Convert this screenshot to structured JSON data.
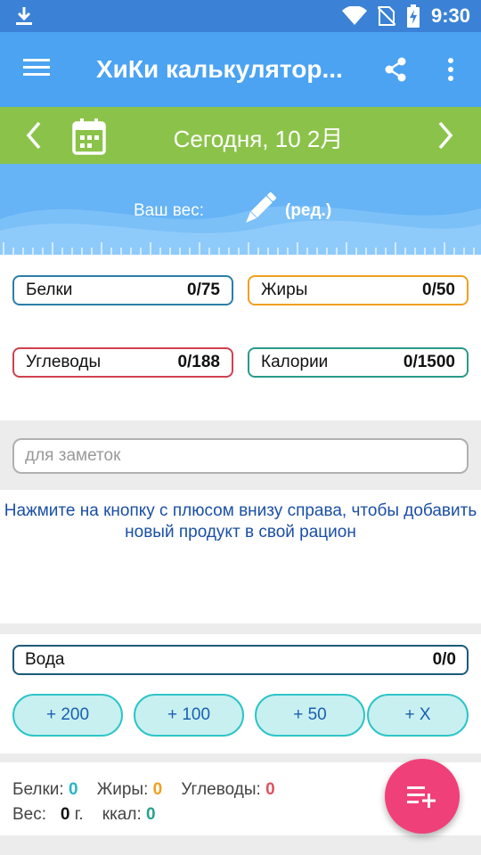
{
  "status_bar": {
    "time": "9:30"
  },
  "app_bar": {
    "title": "ХиКи калькулятор..."
  },
  "date_bar": {
    "date": "Сегодня, 10 2月"
  },
  "weight": {
    "label": "Ваш вес:",
    "edit_label": "(ред.)"
  },
  "macros": {
    "protein": {
      "label": "Белки",
      "value": "0/75"
    },
    "fat": {
      "label": "Жиры",
      "value": "0/50"
    },
    "carbs": {
      "label": "Углеводы",
      "value": "0/188"
    },
    "calories": {
      "label": "Калории",
      "value": "0/1500"
    }
  },
  "notes": {
    "placeholder": "для заметок"
  },
  "hint": {
    "text": "Нажмите на кнопку с плюсом внизу справа, чтобы добавить новый продукт в свой рацион"
  },
  "water": {
    "label": "Вода",
    "value": "0/0",
    "buttons": [
      "+ 200",
      "+ 100",
      "+ 50",
      "+ X"
    ]
  },
  "summary": {
    "protein_label": "Белки:",
    "protein_value": "0",
    "fat_label": "Жиры:",
    "fat_value": "0",
    "carbs_label": "Углеводы:",
    "carbs_value": "0",
    "weight_label": "Вес:",
    "weight_value": "0",
    "weight_unit": "г.",
    "kcal_label": "ккал:",
    "kcal_value": "0"
  },
  "colors": {
    "status_bar": "#3b82d6",
    "app_bar": "#4ba3f2",
    "date_bar": "#8bc34a",
    "fab": "#f0407a",
    "protein": "#2a7fa8",
    "fat": "#f0a020",
    "carbs": "#d04050",
    "calories": "#2a9a8a"
  },
  "icons": {
    "status": [
      "download-icon",
      "wifi-icon",
      "no-sim-icon",
      "battery-charging-icon"
    ],
    "app_bar": [
      "menu-icon",
      "share-icon",
      "more-vert-icon"
    ],
    "date_bar": [
      "chevron-left-icon",
      "calendar-icon",
      "chevron-right-icon"
    ],
    "weight": "pencil-icon",
    "fab": "playlist-add-icon"
  }
}
